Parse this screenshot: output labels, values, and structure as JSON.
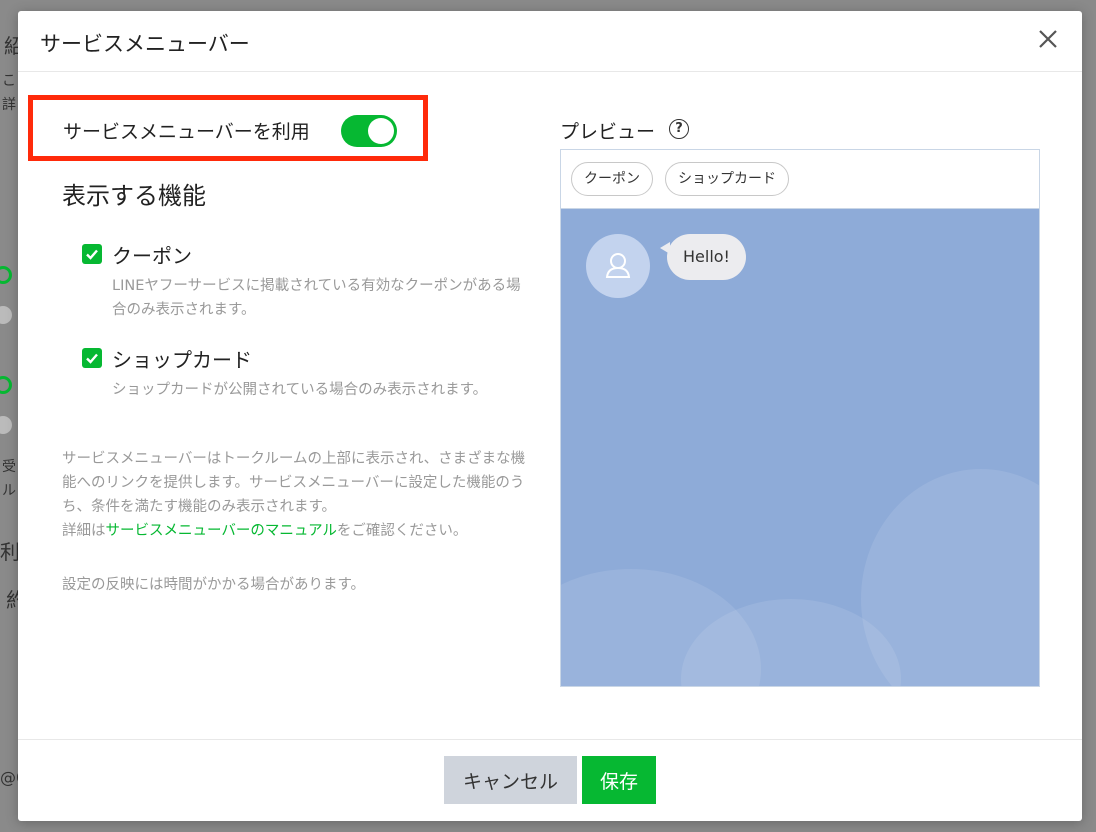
{
  "background": {
    "fragments": [
      "紹",
      "こ",
      "詳",
      "受",
      "ル",
      "利",
      "約",
      "@0"
    ]
  },
  "modal": {
    "title": "サービスメニューバー",
    "close_icon": "close-icon"
  },
  "settings": {
    "toggle_label": "サービスメニューバーを利用",
    "toggle_on": true,
    "section_title": "表示する機能",
    "features": [
      {
        "label": "クーポン",
        "checked": true,
        "description": "LINEヤフーサービスに掲載されている有効なクーポンがある場合のみ表示されます。"
      },
      {
        "label": "ショップカード",
        "checked": true,
        "description": "ショップカードが公開されている場合のみ表示されます。"
      }
    ],
    "info_text": "サービスメニューバーはトークルームの上部に表示され、さまざまな機能へのリンクを提供します。サービスメニューバーに設定した機能のうち、条件を満たす機能のみ表示されます。",
    "info_prefix": "詳細は",
    "info_link": "サービスメニューバーのマニュアル",
    "info_suffix": "をご確認ください。",
    "note": "設定の反映には時間がかかる場合があります。"
  },
  "preview": {
    "label": "プレビュー",
    "help": "?",
    "chips": [
      "クーポン",
      "ショップカード"
    ],
    "message": "Hello!",
    "colors": {
      "chat_bg": "#8eabd8"
    }
  },
  "footer": {
    "cancel_label": "キャンセル",
    "save_label": "保存"
  },
  "colors": {
    "accent": "#06b832",
    "highlight_border": "#ff2a0a"
  }
}
